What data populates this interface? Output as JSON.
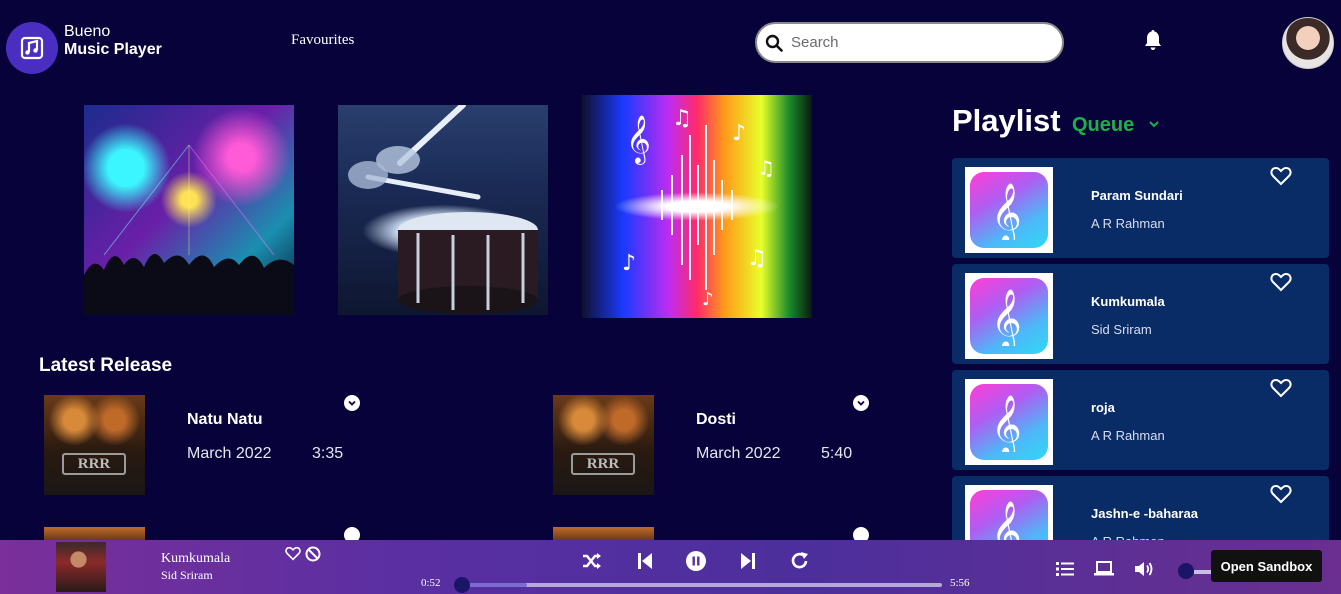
{
  "brand": {
    "line1": "Bueno",
    "line2": "Music Player",
    "logo_icon": "music-note-icon"
  },
  "nav": {
    "favourites": "Favourites"
  },
  "search": {
    "placeholder": "Search",
    "icon": "search-icon"
  },
  "header_icons": {
    "bell": "bell-icon",
    "avatar": "user-avatar"
  },
  "featured": [
    {
      "name": "concert-crowd-image"
    },
    {
      "name": "drummer-image"
    },
    {
      "name": "music-notes-wave-image"
    }
  ],
  "latest_release": {
    "title": "Latest Release",
    "items": [
      {
        "title": "Natu Natu",
        "date": "March 2022",
        "duration": "3:35",
        "cover_text": "RRR"
      },
      {
        "title": "Dosti",
        "date": "March 2022",
        "duration": "5:40",
        "cover_text": "RRR"
      }
    ]
  },
  "playlist": {
    "title": "Playlist",
    "queue_label": "Queue",
    "items": [
      {
        "song": "Param Sundari",
        "artist": "A R Rahman"
      },
      {
        "song": "Kumkumala",
        "artist": "Sid Sriram"
      },
      {
        "song": "roja",
        "artist": "A R Rahman"
      },
      {
        "song": "Jashn-e -baharaa",
        "artist": "A R Rahman"
      }
    ]
  },
  "player": {
    "title": "Kumkumala",
    "artist": "Sid Sriram",
    "current_time": "0:52",
    "total_time": "5:56",
    "progress_fraction": 0.146,
    "controls": [
      "shuffle-icon",
      "previous-icon",
      "pause-icon",
      "next-icon",
      "repeat-icon"
    ],
    "right_icons": [
      "queue-list-icon",
      "device-icon",
      "volume-icon"
    ]
  },
  "sandbox_button": "Open Sandbox",
  "colors": {
    "background": "#07033a",
    "card": "#0a2c66",
    "accent_green": "#1fae4a",
    "logo": "#4a2ec2"
  }
}
